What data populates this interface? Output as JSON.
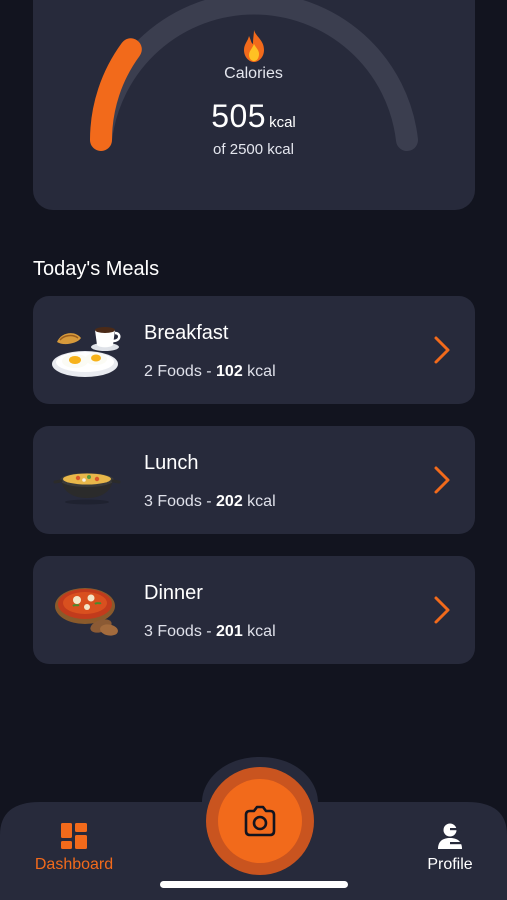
{
  "calories": {
    "icon": "fire-icon",
    "label": "Calories",
    "value": "505",
    "unit": "kcal",
    "goal_text": "of 2500 kcal",
    "consumed": 505,
    "goal": 2500,
    "progress_fraction": 0.202,
    "accent_color": "#f26a1b",
    "track_color": "#3b3e4f"
  },
  "meals": {
    "title": "Today's Meals",
    "items": [
      {
        "name": "Breakfast",
        "count_text": "2 Foods - ",
        "kcal_value": "102",
        "kcal_unit": " kcal",
        "icon": "breakfast-plate-icon"
      },
      {
        "name": "Lunch",
        "count_text": "3 Foods - ",
        "kcal_value": "202",
        "kcal_unit": " kcal",
        "icon": "lunch-pan-icon"
      },
      {
        "name": "Dinner",
        "count_text": "3 Foods - ",
        "kcal_value": "201",
        "kcal_unit": " kcal",
        "icon": "dinner-bowl-icon"
      }
    ]
  },
  "nav": {
    "dashboard_label": "Dashboard",
    "profile_label": "Profile",
    "active": "Dashboard",
    "active_color": "#f26a1b",
    "camera_icon": "camera-icon"
  }
}
